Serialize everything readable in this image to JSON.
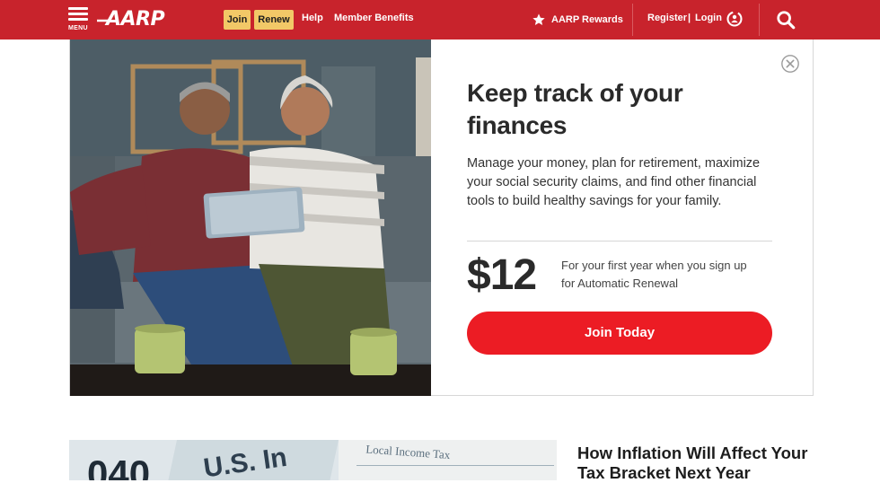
{
  "header": {
    "menu_label": "MENU",
    "logo_text": "AARP",
    "join_label": "Join",
    "renew_label": "Renew",
    "help_label": "Help",
    "benefits_label": "Member Benefits",
    "rewards_label": "AARP Rewards",
    "register_label": "Register",
    "separator": "|",
    "login_label": "Login",
    "icons": [
      "menu-icon",
      "star-icon",
      "login-icon",
      "search-icon"
    ],
    "colors": {
      "bar": "#c8232c",
      "yellow_button": "#f2c867"
    }
  },
  "promo": {
    "title": "Keep track of your finances",
    "description": "Manage your money, plan for retirement, maximize your social security claims, and find other financial tools to build healthy savings for your family.",
    "price": "$12",
    "price_note": "For your first year when you sign up for Automatic Renewal",
    "cta_label": "Join Today",
    "close_icon": "close-icon",
    "colors": {
      "cta": "#ec1c24"
    }
  },
  "article": {
    "title": "How Inflation Will Affect Your Tax Bracket Next Year"
  }
}
